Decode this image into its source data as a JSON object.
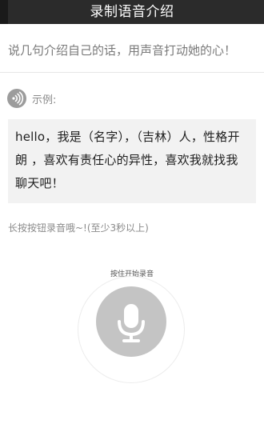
{
  "header": {
    "title": "录制语音介绍"
  },
  "prompt": {
    "text": "说几句介绍自己的话，用声音打动她的心！"
  },
  "example": {
    "icon": "sound-wave-icon",
    "label": "示例:",
    "text": "hello，我是（名字），（吉林）人，性格开朗 ，喜欢有责任心的异性，喜欢我就找我聊天吧！"
  },
  "record": {
    "hint": "长按按钮录音哦~!(至少3秒以上)",
    "button_label": "按住开始录音",
    "icon": "microphone-icon"
  },
  "colors": {
    "titlebar": "#2b2b2b",
    "example_bg": "#f2f2f2",
    "mic_button": "#c4c4c4"
  }
}
